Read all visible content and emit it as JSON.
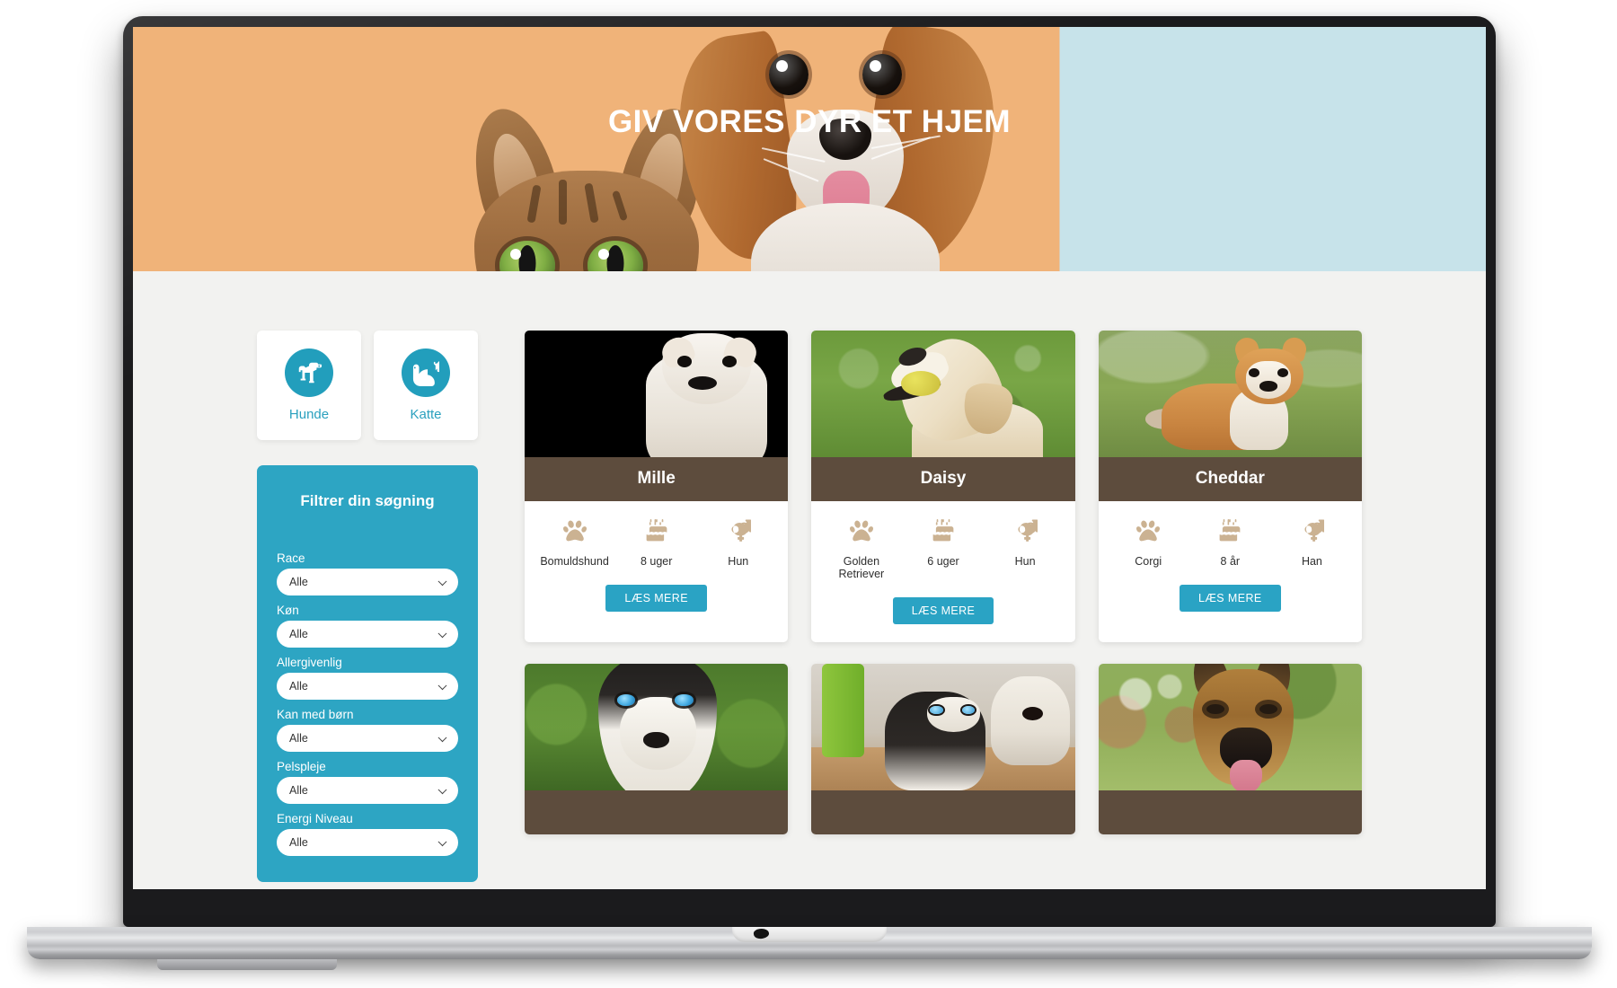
{
  "hero": {
    "title": "GIV VORES DYR ET HJEM",
    "left_color": "#f0b379",
    "right_color": "#c7e3ea"
  },
  "theme": {
    "accent": "#2aa3c4",
    "filter_panel": "#2da5c3",
    "name_bar": "#5d4c3d",
    "attr_icon": "#cbb292",
    "page_bg": "#f2f2f0"
  },
  "sidebar": {
    "type_switch": [
      {
        "label": "Hunde",
        "icon": "dog-icon"
      },
      {
        "label": "Katte",
        "icon": "cat-icon"
      }
    ],
    "filter": {
      "title": "Filtrer din søgning",
      "groups": [
        {
          "label": "Race",
          "value": "Alle"
        },
        {
          "label": "Køn",
          "value": "Alle"
        },
        {
          "label": "Allergivenlig",
          "value": "Alle"
        },
        {
          "label": "Kan med børn",
          "value": "Alle"
        },
        {
          "label": "Pelspleje",
          "value": "Alle"
        },
        {
          "label": "Energi Niveau",
          "value": "Alle"
        }
      ]
    }
  },
  "cards": [
    {
      "name": "Mille",
      "photo": "white-terrier-puppy-on-black",
      "breed": "Bomuldshund",
      "age": "8 uger",
      "sex": "Hun",
      "button": "LÆS MERE"
    },
    {
      "name": "Daisy",
      "photo": "golden-retriever-with-ball",
      "breed": "Golden Retriever",
      "age": "6 uger",
      "sex": "Hun",
      "button": "LÆS MERE"
    },
    {
      "name": "Cheddar",
      "photo": "corgi-in-grass",
      "breed": "Corgi",
      "age": "8 år",
      "sex": "Han",
      "button": "LÆS MERE"
    }
  ],
  "cards_row2": [
    {
      "photo": "husky-closeup-in-grass"
    },
    {
      "photo": "husky-puppies-indoors"
    },
    {
      "photo": "german-shepherd-outdoors"
    }
  ],
  "icons": {
    "breed": "paw-icon",
    "age": "birthday-cake-icon",
    "sex": "gender-venus-mars-icon",
    "dropdown": "chevron-down-icon"
  }
}
